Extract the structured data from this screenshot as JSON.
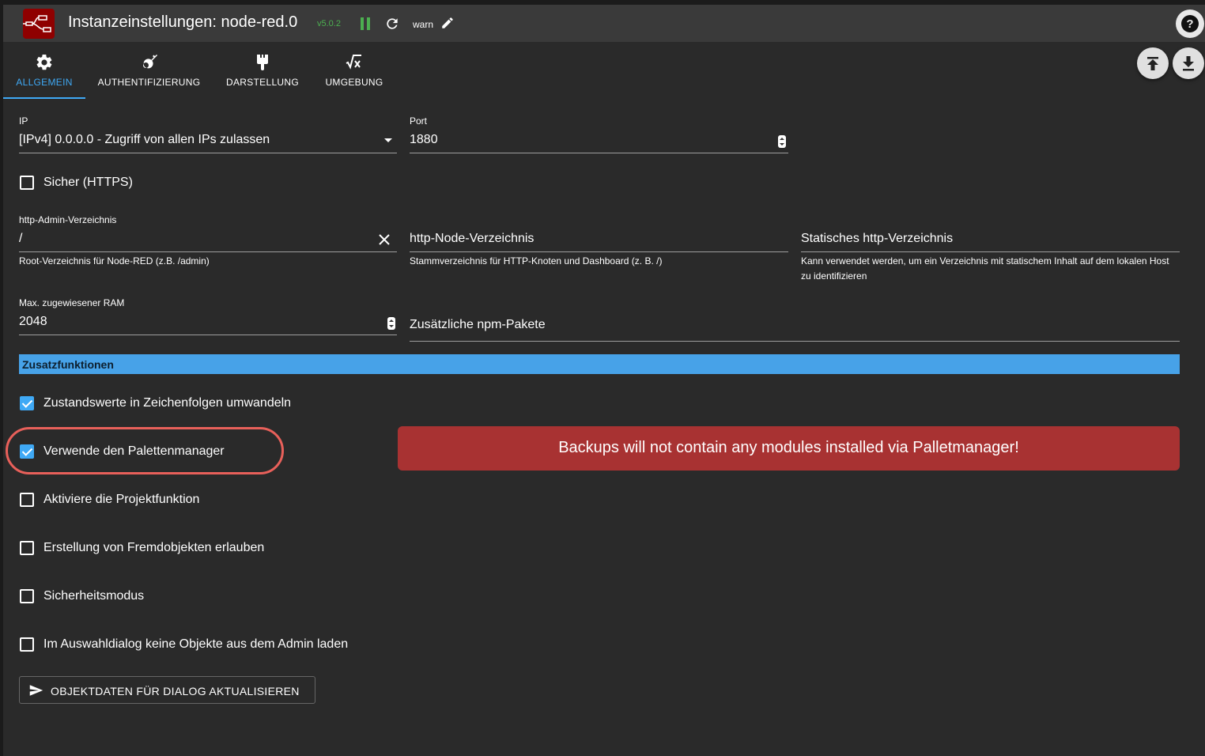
{
  "header": {
    "title": "Instanzeinstellungen: node-red.0",
    "version": "v5.0.2",
    "log_level": "warn",
    "icons": {
      "logo": "node-red-logo",
      "pause": "pause-icon",
      "reload": "reload-icon",
      "edit": "edit-icon",
      "help": "help-icon"
    }
  },
  "tabs": [
    {
      "label": "ALLGEMEIN",
      "icon": "gear-icon",
      "active": true
    },
    {
      "label": "AUTHENTIFIZIERUNG",
      "icon": "key-icon",
      "active": false
    },
    {
      "label": "DARSTELLUNG",
      "icon": "brush-icon",
      "active": false
    },
    {
      "label": "UMGEBUNG",
      "icon": "function-icon",
      "active": false
    }
  ],
  "fabs": {
    "upload_icon": "upload-icon",
    "download_icon": "download-icon"
  },
  "fields": {
    "ip": {
      "label": "IP",
      "value": "[IPv4] 0.0.0.0 - Zugriff von allen IPs zulassen"
    },
    "port": {
      "label": "Port",
      "value": "1880"
    },
    "https": {
      "label": "Sicher (HTTPS)",
      "checked": false
    },
    "admin_dir": {
      "label": "http-Admin-Verzeichnis",
      "value": "/",
      "helper": "Root-Verzeichnis für Node-RED (z.B. /admin)"
    },
    "node_dir": {
      "label": "http-Node-Verzeichnis",
      "helper": "Stammverzeichnis für HTTP-Knoten und Dashboard (z. B. /)"
    },
    "static_dir": {
      "label": "Statisches http-Verzeichnis",
      "helper": "Kann verwendet werden, um ein Verzeichnis mit statischem Inhalt auf dem lokalen Host zu identifizieren"
    },
    "max_ram": {
      "label": "Max. zugewiesener RAM",
      "value": "2048"
    },
    "npm_packages": {
      "label": "Zusätzliche npm-Pakete"
    }
  },
  "section": {
    "title": "Zusatzfunktionen"
  },
  "options": [
    {
      "label": "Zustandswerte in Zeichenfolgen umwandeln",
      "checked": true
    },
    {
      "label": "Verwende den Palettenmanager",
      "checked": true
    },
    {
      "label": "Aktiviere die Projektfunktion",
      "checked": false
    },
    {
      "label": "Erstellung von Fremdobjekten erlauben",
      "checked": false
    },
    {
      "label": "Sicherheitsmodus",
      "checked": false
    },
    {
      "label": "Im Auswahldialog keine Objekte aus dem Admin laden",
      "checked": false
    }
  ],
  "warning": {
    "text": "Backups will not contain any modules installed via Palletmanager!",
    "color": "#a83232"
  },
  "action_button": {
    "label": "OBJEKTDATEN FÜR DIALOG AKTUALISIEREN",
    "icon": "send-icon"
  },
  "colors": {
    "accent": "#3fa9f5",
    "section": "#47a2e8",
    "highlight": "#e8605a"
  }
}
